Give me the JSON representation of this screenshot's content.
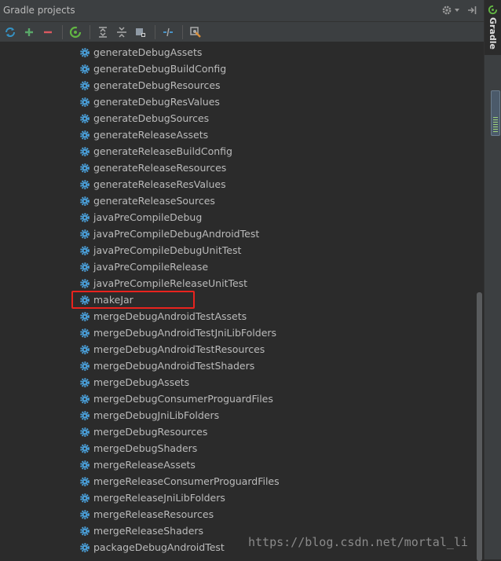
{
  "header": {
    "title": "Gradle projects",
    "icons": [
      "gear-icon",
      "dropdown-arrow-icon",
      "hide-panel-icon"
    ]
  },
  "toolbar": {
    "buttons": [
      {
        "name": "refresh-all-projects-button",
        "icon": "refresh-icon"
      },
      {
        "name": "link-gradle-project-button",
        "icon": "plus-icon"
      },
      {
        "name": "unlink-gradle-project-button",
        "icon": "minus-icon"
      },
      {
        "name": "execute-gradle-task-button",
        "icon": "gradle-run-icon"
      },
      {
        "name": "expand-all-button",
        "icon": "expand-all-icon"
      },
      {
        "name": "collapse-all-button",
        "icon": "collapse-all-icon"
      },
      {
        "name": "offline-mode-button",
        "icon": "offline-icon"
      },
      {
        "name": "toggle-skip-tests-button",
        "icon": "skip-tests-icon"
      },
      {
        "name": "gradle-settings-button",
        "icon": "wrench-icon"
      }
    ]
  },
  "tasks": [
    "generateDebugAssets",
    "generateDebugBuildConfig",
    "generateDebugResources",
    "generateDebugResValues",
    "generateDebugSources",
    "generateReleaseAssets",
    "generateReleaseBuildConfig",
    "generateReleaseResources",
    "generateReleaseResValues",
    "generateReleaseSources",
    "javaPreCompileDebug",
    "javaPreCompileDebugAndroidTest",
    "javaPreCompileDebugUnitTest",
    "javaPreCompileRelease",
    "javaPreCompileReleaseUnitTest",
    "makeJar",
    "mergeDebugAndroidTestAssets",
    "mergeDebugAndroidTestJniLibFolders",
    "mergeDebugAndroidTestResources",
    "mergeDebugAndroidTestShaders",
    "mergeDebugAssets",
    "mergeDebugConsumerProguardFiles",
    "mergeDebugJniLibFolders",
    "mergeDebugResources",
    "mergeDebugShaders",
    "mergeReleaseAssets",
    "mergeReleaseConsumerProguardFiles",
    "mergeReleaseJniLibFolders",
    "mergeReleaseResources",
    "mergeReleaseShaders",
    "packageDebugAndroidTest"
  ],
  "highlighted_task": "makeJar",
  "side_tab": {
    "label": "Gradle"
  },
  "watermark": "https://blog.csdn.net/mortal_li",
  "colors": {
    "background": "#2b2b2b",
    "panel": "#3c3f41",
    "text": "#bbbbbb",
    "gear_icon": "#4a9fd9",
    "highlight_border": "#e8231e",
    "refresh_icon": "#3592c4",
    "plus_icon": "#59a869",
    "minus_icon": "#db5860",
    "gradle_icon": "#62b543"
  }
}
